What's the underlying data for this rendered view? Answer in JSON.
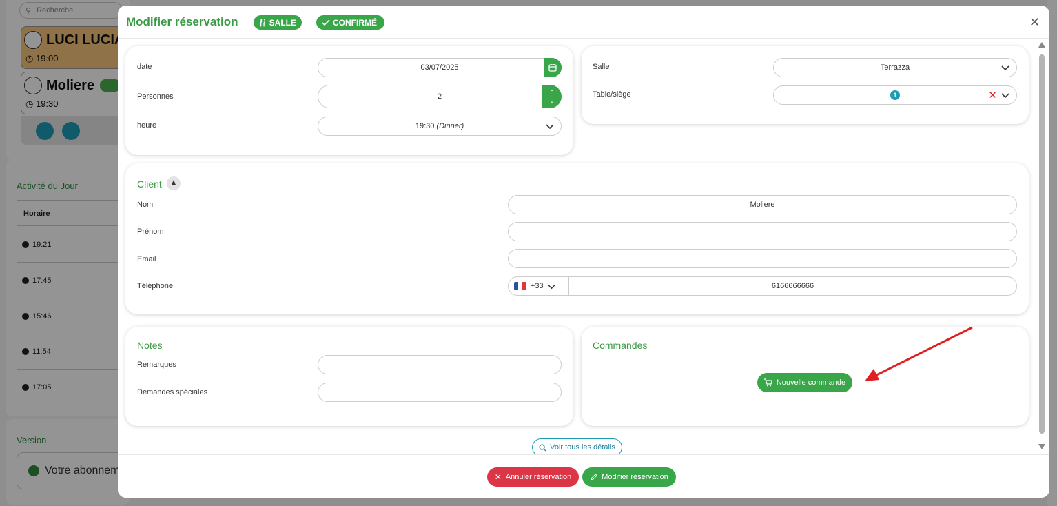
{
  "background": {
    "search_placeholder": "Recherche",
    "card1_name": "LUCI LUCIA",
    "card1_time": "19:00",
    "card2_name": "Moliere",
    "card2_time": "19:30",
    "activity_title": "Activité du Jour",
    "col_horaire": "Horaire",
    "rows": [
      "19:21",
      "17:45",
      "15:46",
      "11:54",
      "17:05"
    ],
    "version_title": "Version",
    "subscription_text": "Votre abonnem"
  },
  "modal": {
    "title": "Modifier réservation",
    "badge_salle": "SALLE",
    "badge_confirme": "CONFIRMÉ",
    "close_icon": "close-icon"
  },
  "booking": {
    "date_label": "date",
    "date_value": "03/07/2025",
    "persons_label": "Personnes",
    "persons_value": "2",
    "hour_label": "heure",
    "hour_value": "19:30",
    "hour_service": "(Dinner)"
  },
  "room": {
    "salle_label": "Salle",
    "salle_value": "Terrazza",
    "table_label": "Table/siège",
    "table_badge": "1"
  },
  "client": {
    "section_title": "Client",
    "nom_label": "Nom",
    "nom_value": "Moliere",
    "prenom_label": "Prénom",
    "prenom_value": "",
    "email_label": "Email",
    "email_value": "",
    "tel_label": "Téléphone",
    "tel_code": "+33",
    "tel_value": "6166666666"
  },
  "notes": {
    "section_title": "Notes",
    "remarques_label": "Remarques",
    "remarques_value": "",
    "demandes_label": "Demandes spéciales",
    "demandes_value": ""
  },
  "commandes": {
    "section_title": "Commandes",
    "new_order_label": "Nouvelle commande"
  },
  "details_link": "Voir tous les détails",
  "footer": {
    "cancel_label": "Annuler réservation",
    "modify_label": "Modifier réservation"
  },
  "colors": {
    "green": "#3aa64a",
    "title_green": "#3a9b45",
    "danger": "#dc3545",
    "teal": "#1e9bb5",
    "annotation_arrow": "#e02020"
  }
}
